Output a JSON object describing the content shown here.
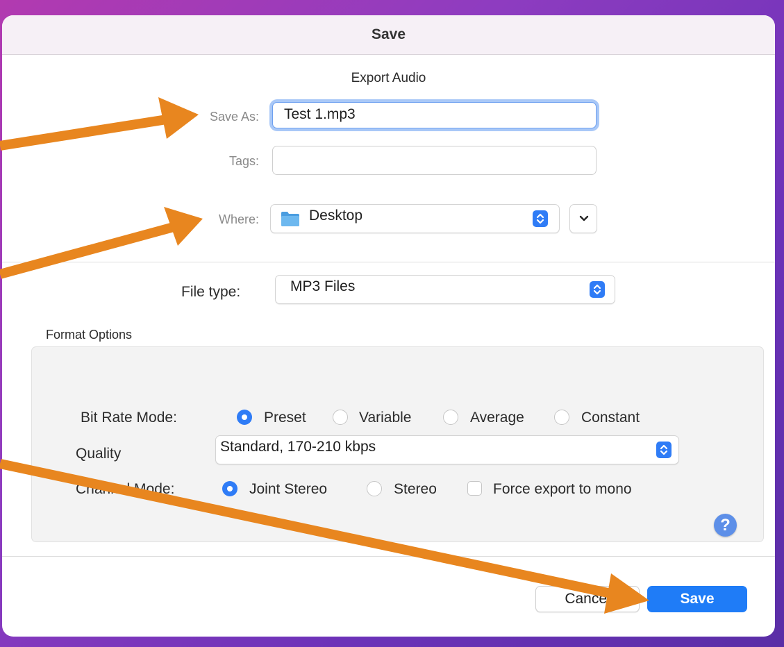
{
  "window": {
    "title": "Save"
  },
  "dialog": {
    "subtitle": "Export Audio",
    "save_as": {
      "label": "Save As:",
      "value": "Test 1.mp3"
    },
    "tags": {
      "label": "Tags:",
      "value": ""
    },
    "where": {
      "label": "Where:",
      "value": "Desktop",
      "icon": "folder-icon"
    },
    "file_type": {
      "label": "File type:",
      "value": "MP3 Files"
    }
  },
  "format_options": {
    "title": "Format Options",
    "bit_rate_mode": {
      "label": "Bit Rate Mode:",
      "options": [
        "Preset",
        "Variable",
        "Average",
        "Constant"
      ],
      "selected": "Preset"
    },
    "quality": {
      "label": "Quality",
      "value": "Standard, 170-210 kbps"
    },
    "channel_mode": {
      "label": "Channel Mode:",
      "options": [
        "Joint Stereo",
        "Stereo"
      ],
      "selected": "Joint Stereo",
      "force_mono_label": "Force export to mono",
      "force_mono_checked": false
    },
    "help_label": "?"
  },
  "buttons": {
    "cancel": "Cancel",
    "save": "Save"
  },
  "colors": {
    "accent": "#1f7cf7",
    "annotation_arrow": "#e8861f",
    "background_gradient": [
      "#b23ab0",
      "#5a2ea6"
    ]
  }
}
